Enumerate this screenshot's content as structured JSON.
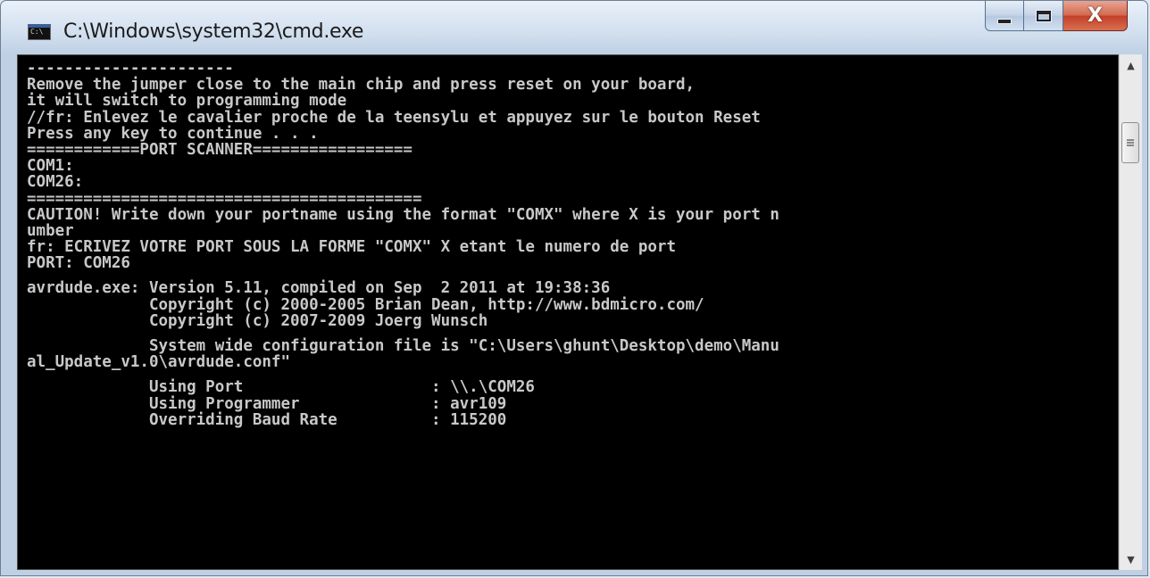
{
  "window": {
    "title": "C:\\Windows\\system32\\cmd.exe",
    "icon": "cmd-icon",
    "icon_caption": "C:\\",
    "close_glyph": "X"
  },
  "console": {
    "lines": [
      "----------------------",
      "Remove the jumper close to the main chip and press reset on your board,",
      "it will switch to programming mode",
      "//fr: Enlevez le cavalier proche de la teensylu et appuyez sur le bouton Reset",
      "Press any key to continue . . .",
      "============PORT SCANNER=================",
      "COM1:",
      "COM26:",
      "==========================================",
      "CAUTION! Write down your portname using the format \"COMX\" where X is your port n",
      "umber",
      "fr: ECRIVEZ VOTRE PORT SOUS LA FORME \"COMX\" X etant le numero de port",
      "PORT: COM26",
      "",
      "avrdude.exe: Version 5.11, compiled on Sep  2 2011 at 19:38:36",
      "             Copyright (c) 2000-2005 Brian Dean, http://www.bdmicro.com/",
      "             Copyright (c) 2007-2009 Joerg Wunsch",
      "",
      "             System wide configuration file is \"C:\\Users\\ghunt\\Desktop\\demo\\Manu",
      "al_Update_v1.0\\avrdude.conf\"",
      "",
      "             Using Port                    : \\\\.\\COM26",
      "             Using Programmer              : avr109",
      "             Overriding Baud Rate          : 115200"
    ]
  },
  "scrollbar": {
    "up_arrow": "▲",
    "down_arrow": "▼"
  },
  "colors": {
    "console_bg": "#000000",
    "console_text": "#c8c8c8",
    "close_button": "#c2402a"
  }
}
